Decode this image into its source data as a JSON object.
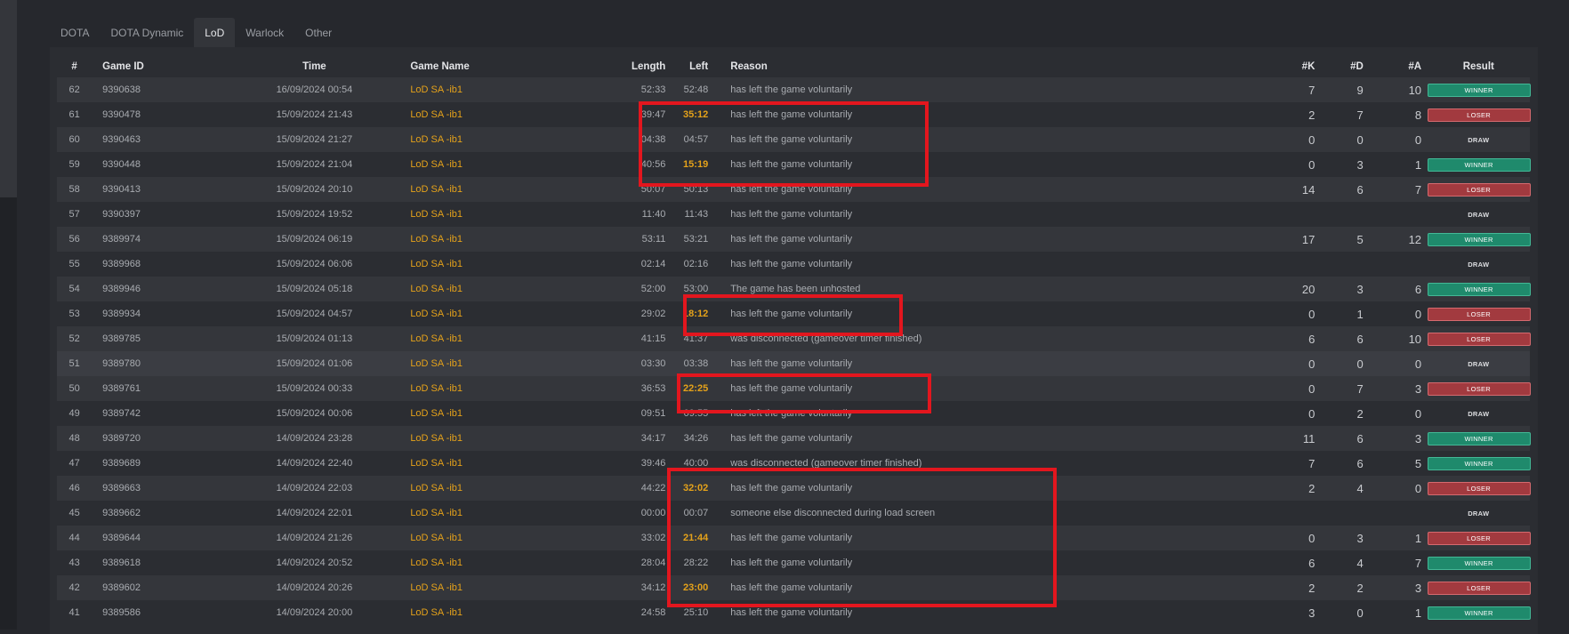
{
  "tabs": [
    {
      "label": "DOTA"
    },
    {
      "label": "DOTA Dynamic"
    },
    {
      "label": "LoD"
    },
    {
      "label": "Warlock"
    },
    {
      "label": "Other"
    }
  ],
  "active_tab": "LoD",
  "columns": [
    "#",
    "Game ID",
    "Time",
    "Game Name",
    "Length",
    "Left",
    "Reason",
    "#K",
    "#D",
    "#A",
    "Result"
  ],
  "colors": {
    "winner": "#1f8a6c",
    "loser": "#a23a3f",
    "highlight": "#e3161e",
    "game_name": "#e5a21a"
  },
  "rows": [
    {
      "n": "62",
      "id": "9390638",
      "time": "16/09/2024 00:54",
      "name": "LoD SA -ib1",
      "length": "52:33",
      "left": "52:48",
      "reason": "has left the game voluntarily",
      "k": "7",
      "d": "9",
      "a": "10",
      "result": "WINNER",
      "left_hl": false
    },
    {
      "n": "61",
      "id": "9390478",
      "time": "15/09/2024 21:43",
      "name": "LoD SA -ib1",
      "length": "39:47",
      "left": "35:12",
      "reason": "has left the game voluntarily",
      "k": "2",
      "d": "7",
      "a": "8",
      "result": "LOSER",
      "left_hl": true
    },
    {
      "n": "60",
      "id": "9390463",
      "time": "15/09/2024 21:27",
      "name": "LoD SA -ib1",
      "length": "04:38",
      "left": "04:57",
      "reason": "has left the game voluntarily",
      "k": "0",
      "d": "0",
      "a": "0",
      "result": "DRAW",
      "left_hl": false
    },
    {
      "n": "59",
      "id": "9390448",
      "time": "15/09/2024 21:04",
      "name": "LoD SA -ib1",
      "length": "40:56",
      "left": "15:19",
      "reason": "has left the game voluntarily",
      "k": "0",
      "d": "3",
      "a": "1",
      "result": "WINNER",
      "left_hl": true
    },
    {
      "n": "58",
      "id": "9390413",
      "time": "15/09/2024 20:10",
      "name": "LoD SA -ib1",
      "length": "50:07",
      "left": "50:13",
      "reason": "has left the game voluntarily",
      "k": "14",
      "d": "6",
      "a": "7",
      "result": "LOSER",
      "left_hl": false
    },
    {
      "n": "57",
      "id": "9390397",
      "time": "15/09/2024 19:52",
      "name": "LoD SA -ib1",
      "length": "11:40",
      "left": "11:43",
      "reason": "has left the game voluntarily",
      "k": "",
      "d": "",
      "a": "",
      "result": "DRAW",
      "left_hl": false
    },
    {
      "n": "56",
      "id": "9389974",
      "time": "15/09/2024 06:19",
      "name": "LoD SA -ib1",
      "length": "53:11",
      "left": "53:21",
      "reason": "has left the game voluntarily",
      "k": "17",
      "d": "5",
      "a": "12",
      "result": "WINNER",
      "left_hl": false
    },
    {
      "n": "55",
      "id": "9389968",
      "time": "15/09/2024 06:06",
      "name": "LoD SA -ib1",
      "length": "02:14",
      "left": "02:16",
      "reason": "has left the game voluntarily",
      "k": "",
      "d": "",
      "a": "",
      "result": "DRAW",
      "left_hl": false
    },
    {
      "n": "54",
      "id": "9389946",
      "time": "15/09/2024 05:18",
      "name": "LoD SA -ib1",
      "length": "52:00",
      "left": "53:00",
      "reason": "The game has been unhosted",
      "k": "20",
      "d": "3",
      "a": "6",
      "result": "WINNER",
      "left_hl": false
    },
    {
      "n": "53",
      "id": "9389934",
      "time": "15/09/2024 04:57",
      "name": "LoD SA -ib1",
      "length": "29:02",
      "left": "18:12",
      "reason": "has left the game voluntarily",
      "k": "0",
      "d": "1",
      "a": "0",
      "result": "LOSER",
      "left_hl": true
    },
    {
      "n": "52",
      "id": "9389785",
      "time": "15/09/2024 01:13",
      "name": "LoD SA -ib1",
      "length": "41:15",
      "left": "41:37",
      "reason": "was disconnected (gameover timer finished)",
      "k": "6",
      "d": "6",
      "a": "10",
      "result": "LOSER",
      "left_hl": false
    },
    {
      "n": "51",
      "id": "9389780",
      "time": "15/09/2024 01:06",
      "name": "LoD SA -ib1",
      "length": "03:30",
      "left": "03:38",
      "reason": "has left the game voluntarily",
      "k": "0",
      "d": "0",
      "a": "0",
      "result": "DRAW",
      "left_hl": false
    },
    {
      "n": "50",
      "id": "9389761",
      "time": "15/09/2024 00:33",
      "name": "LoD SA -ib1",
      "length": "36:53",
      "left": "22:25",
      "reason": "has left the game voluntarily",
      "k": "0",
      "d": "7",
      "a": "3",
      "result": "LOSER",
      "left_hl": true
    },
    {
      "n": "49",
      "id": "9389742",
      "time": "15/09/2024 00:06",
      "name": "LoD SA -ib1",
      "length": "09:51",
      "left": "09:55",
      "reason": "has left the game voluntarily",
      "k": "0",
      "d": "2",
      "a": "0",
      "result": "DRAW",
      "left_hl": false
    },
    {
      "n": "48",
      "id": "9389720",
      "time": "14/09/2024 23:28",
      "name": "LoD SA -ib1",
      "length": "34:17",
      "left": "34:26",
      "reason": "has left the game voluntarily",
      "k": "11",
      "d": "6",
      "a": "3",
      "result": "WINNER",
      "left_hl": false
    },
    {
      "n": "47",
      "id": "9389689",
      "time": "14/09/2024 22:40",
      "name": "LoD SA -ib1",
      "length": "39:46",
      "left": "40:00",
      "reason": "was disconnected (gameover timer finished)",
      "k": "7",
      "d": "6",
      "a": "5",
      "result": "WINNER",
      "left_hl": false
    },
    {
      "n": "46",
      "id": "9389663",
      "time": "14/09/2024 22:03",
      "name": "LoD SA -ib1",
      "length": "44:22",
      "left": "32:02",
      "reason": "has left the game voluntarily",
      "k": "2",
      "d": "4",
      "a": "0",
      "result": "LOSER",
      "left_hl": true
    },
    {
      "n": "45",
      "id": "9389662",
      "time": "14/09/2024 22:01",
      "name": "LoD SA -ib1",
      "length": "00:00",
      "left": "00:07",
      "reason": "someone else disconnected during load screen",
      "k": "",
      "d": "",
      "a": "",
      "result": "DRAW",
      "left_hl": false
    },
    {
      "n": "44",
      "id": "9389644",
      "time": "14/09/2024 21:26",
      "name": "LoD SA -ib1",
      "length": "33:02",
      "left": "21:44",
      "reason": "has left the game voluntarily",
      "k": "0",
      "d": "3",
      "a": "1",
      "result": "LOSER",
      "left_hl": true
    },
    {
      "n": "43",
      "id": "9389618",
      "time": "14/09/2024 20:52",
      "name": "LoD SA -ib1",
      "length": "28:04",
      "left": "28:22",
      "reason": "has left the game voluntarily",
      "k": "6",
      "d": "4",
      "a": "7",
      "result": "WINNER",
      "left_hl": false
    },
    {
      "n": "42",
      "id": "9389602",
      "time": "14/09/2024 20:26",
      "name": "LoD SA -ib1",
      "length": "34:12",
      "left": "23:00",
      "reason": "has left the game voluntarily",
      "k": "2",
      "d": "2",
      "a": "3",
      "result": "LOSER",
      "left_hl": true
    },
    {
      "n": "41",
      "id": "9389586",
      "time": "14/09/2024 20:00",
      "name": "LoD SA -ib1",
      "length": "24:58",
      "left": "25:10",
      "reason": "has left the game voluntarily",
      "k": "3",
      "d": "0",
      "a": "1",
      "result": "WINNER",
      "left_hl": false
    }
  ]
}
